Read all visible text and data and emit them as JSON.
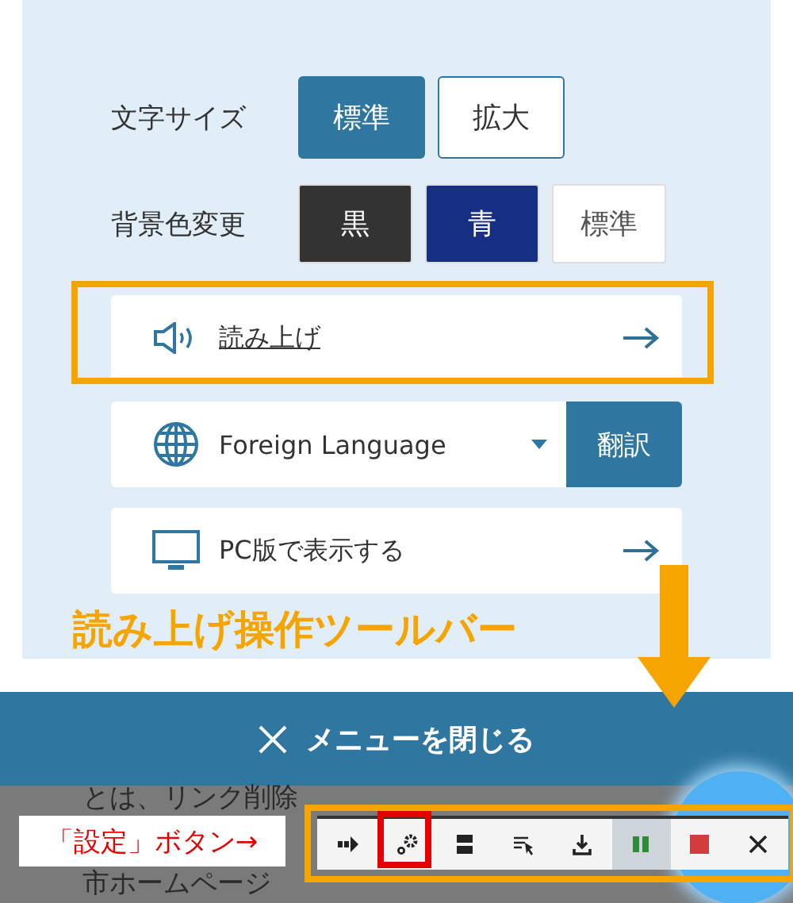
{
  "menu": {
    "rows": [
      {
        "label": "文字サイズ",
        "kind": "size",
        "options": [
          {
            "label": "標準",
            "selected": true
          },
          {
            "label": "拡大",
            "selected": false
          }
        ]
      },
      {
        "label": "背景色変更",
        "kind": "color",
        "options": [
          {
            "label": "黒",
            "color": "#333333"
          },
          {
            "label": "青",
            "color": "#172f82"
          },
          {
            "label": "標準",
            "color": "#ffffff"
          }
        ]
      }
    ],
    "links": [
      {
        "kind": "read",
        "label": "読み上げ"
      },
      {
        "kind": "language",
        "label": "Foreign Language",
        "button": "翻訳"
      },
      {
        "kind": "pc",
        "label": "PC版で表示する"
      }
    ]
  },
  "close_bar": {
    "label": "メニューを閉じる"
  },
  "background_text": [
    "とは、リンク削除",
    "市ホームページ"
  ],
  "toolbar": {
    "buttons": [
      {
        "kind": "forward",
        "selected": false
      },
      {
        "kind": "settings",
        "selected": false
      },
      {
        "kind": "layout",
        "selected": false
      },
      {
        "kind": "select",
        "selected": false
      },
      {
        "kind": "download",
        "selected": false
      },
      {
        "kind": "pause",
        "selected": true
      },
      {
        "kind": "stop",
        "selected": false
      },
      {
        "kind": "close",
        "selected": false
      }
    ]
  },
  "annotations": {
    "toolbar_caption": "読み上げ操作ツールバー",
    "settings_caption": "「設定」ボタン→"
  }
}
